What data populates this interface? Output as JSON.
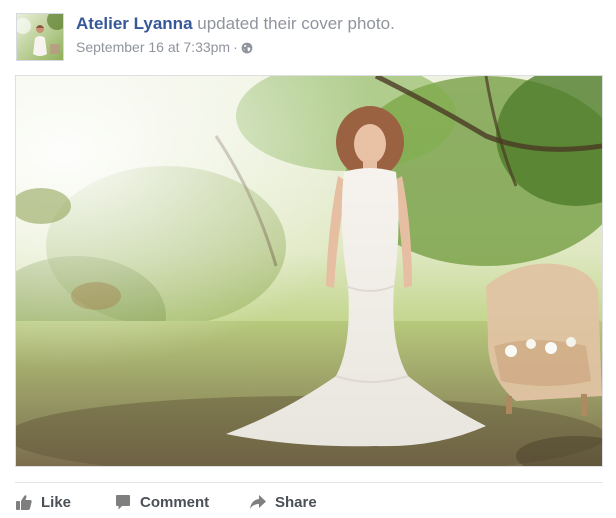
{
  "post": {
    "author": "Atelier Lyanna",
    "action_text": "updated their cover photo.",
    "timestamp": "September 16 at 7:33pm",
    "separator": "·",
    "privacy_icon": "globe-icon"
  },
  "photo": {
    "subject": "bride in white lace mermaid wedding gown standing under trees beside a vintage armchair"
  },
  "actions": {
    "like_label": "Like",
    "comment_label": "Comment",
    "share_label": "Share"
  },
  "colors": {
    "author_link": "#365899",
    "secondary_text": "#90949c",
    "action_text": "#4b4f56",
    "action_icon": "#7f7f7f"
  }
}
